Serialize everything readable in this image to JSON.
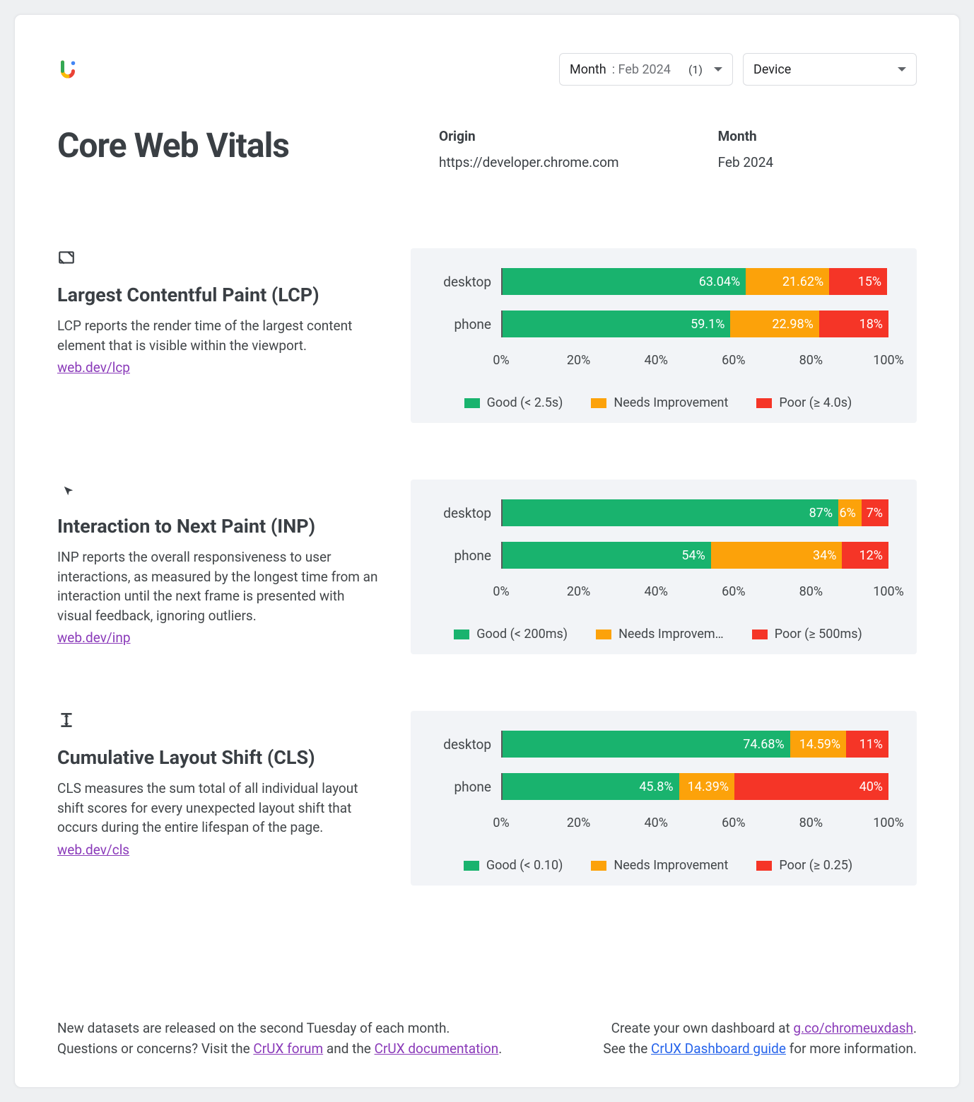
{
  "controls": {
    "month_label": "Month",
    "month_value": ": Feb 2024",
    "month_count": "(1)",
    "device_label": "Device"
  },
  "header": {
    "title": "Core Web Vitals",
    "origin_label": "Origin",
    "origin_value": "https://developer.chrome.com",
    "month_label": "Month",
    "month_value": "Feb 2024"
  },
  "metrics": [
    {
      "icon": "lcp-icon",
      "title": "Largest Contentful Paint (LCP)",
      "desc": "LCP reports the render time of the largest content element that is visible within the viewport.",
      "link": "web.dev/lcp",
      "legend": {
        "good": "Good (< 2.5s)",
        "ni": "Needs Improvement",
        "poor": "Poor (≥ 4.0s)"
      }
    },
    {
      "icon": "inp-icon",
      "title": "Interaction to Next Paint (INP)",
      "desc": "INP reports the overall responsiveness to user interactions, as measured by the longest time from an interaction until the next frame is presented with visual feedback, ignoring outliers.",
      "link": "web.dev/inp",
      "legend": {
        "good": "Good (< 200ms)",
        "ni": "Needs Improvem…",
        "poor": "Poor (≥ 500ms)"
      }
    },
    {
      "icon": "cls-icon",
      "title": "Cumulative Layout Shift (CLS)",
      "desc": "CLS measures the sum total of all individual layout shift scores for every unexpected layout shift that occurs during the entire lifespan of the page.",
      "link": "web.dev/cls",
      "legend": {
        "good": "Good (< 0.10)",
        "ni": "Needs Improvement",
        "poor": "Poor (≥ 0.25)"
      }
    }
  ],
  "axis_ticks": [
    "0%",
    "20%",
    "40%",
    "60%",
    "80%",
    "100%"
  ],
  "footer": {
    "left1a": "New datasets are released on the second Tuesday of each month.",
    "left2a": "Questions or concerns? Visit the ",
    "left2b": "CrUX forum",
    "left2c": " and the ",
    "left2d": "CrUX documentation",
    "left2e": ".",
    "right1a": "Create your own dashboard at ",
    "right1b": "g.co/chromeuxdash",
    "right1c": ".",
    "right2a": "See the ",
    "right2b": "CrUX Dashboard guide",
    "right2c": " for more information."
  },
  "chart_data": [
    {
      "type": "bar",
      "title": "Largest Contentful Paint (LCP)",
      "xlabel": "",
      "ylabel": "",
      "xlim": [
        0,
        100
      ],
      "categories": [
        "desktop",
        "phone"
      ],
      "series": [
        {
          "name": "Good (< 2.5s)",
          "values": [
            63.04,
            59.1
          ],
          "labels": [
            "63.04%",
            "59.1%"
          ],
          "color": "#19b36e"
        },
        {
          "name": "Needs Improvement",
          "values": [
            21.62,
            22.98
          ],
          "labels": [
            "21.62%",
            "22.98%"
          ],
          "color": "#fca20a"
        },
        {
          "name": "Poor (≥ 4.0s)",
          "values": [
            15.0,
            18.0
          ],
          "labels": [
            "15%",
            "18%"
          ],
          "color": "#f53527"
        }
      ]
    },
    {
      "type": "bar",
      "title": "Interaction to Next Paint (INP)",
      "xlabel": "",
      "ylabel": "",
      "xlim": [
        0,
        100
      ],
      "categories": [
        "desktop",
        "phone"
      ],
      "series": [
        {
          "name": "Good (< 200ms)",
          "values": [
            87,
            54
          ],
          "labels": [
            "87%",
            "54%"
          ],
          "color": "#19b36e"
        },
        {
          "name": "Needs Improvement",
          "values": [
            6,
            34
          ],
          "labels": [
            "6%",
            "34%"
          ],
          "color": "#fca20a"
        },
        {
          "name": "Poor (≥ 500ms)",
          "values": [
            7,
            12
          ],
          "labels": [
            "7%",
            "12%"
          ],
          "color": "#f53527"
        }
      ]
    },
    {
      "type": "bar",
      "title": "Cumulative Layout Shift (CLS)",
      "xlabel": "",
      "ylabel": "",
      "xlim": [
        0,
        100
      ],
      "categories": [
        "desktop",
        "phone"
      ],
      "series": [
        {
          "name": "Good (< 0.10)",
          "values": [
            74.68,
            45.8
          ],
          "labels": [
            "74.68%",
            "45.8%"
          ],
          "color": "#19b36e"
        },
        {
          "name": "Needs Improvement",
          "values": [
            14.59,
            14.39
          ],
          "labels": [
            "14.59%",
            "14.39%"
          ],
          "color": "#fca20a"
        },
        {
          "name": "Poor (≥ 0.25)",
          "values": [
            11.0,
            40.0
          ],
          "labels": [
            "11%",
            "40%"
          ],
          "color": "#f53527"
        }
      ]
    }
  ]
}
